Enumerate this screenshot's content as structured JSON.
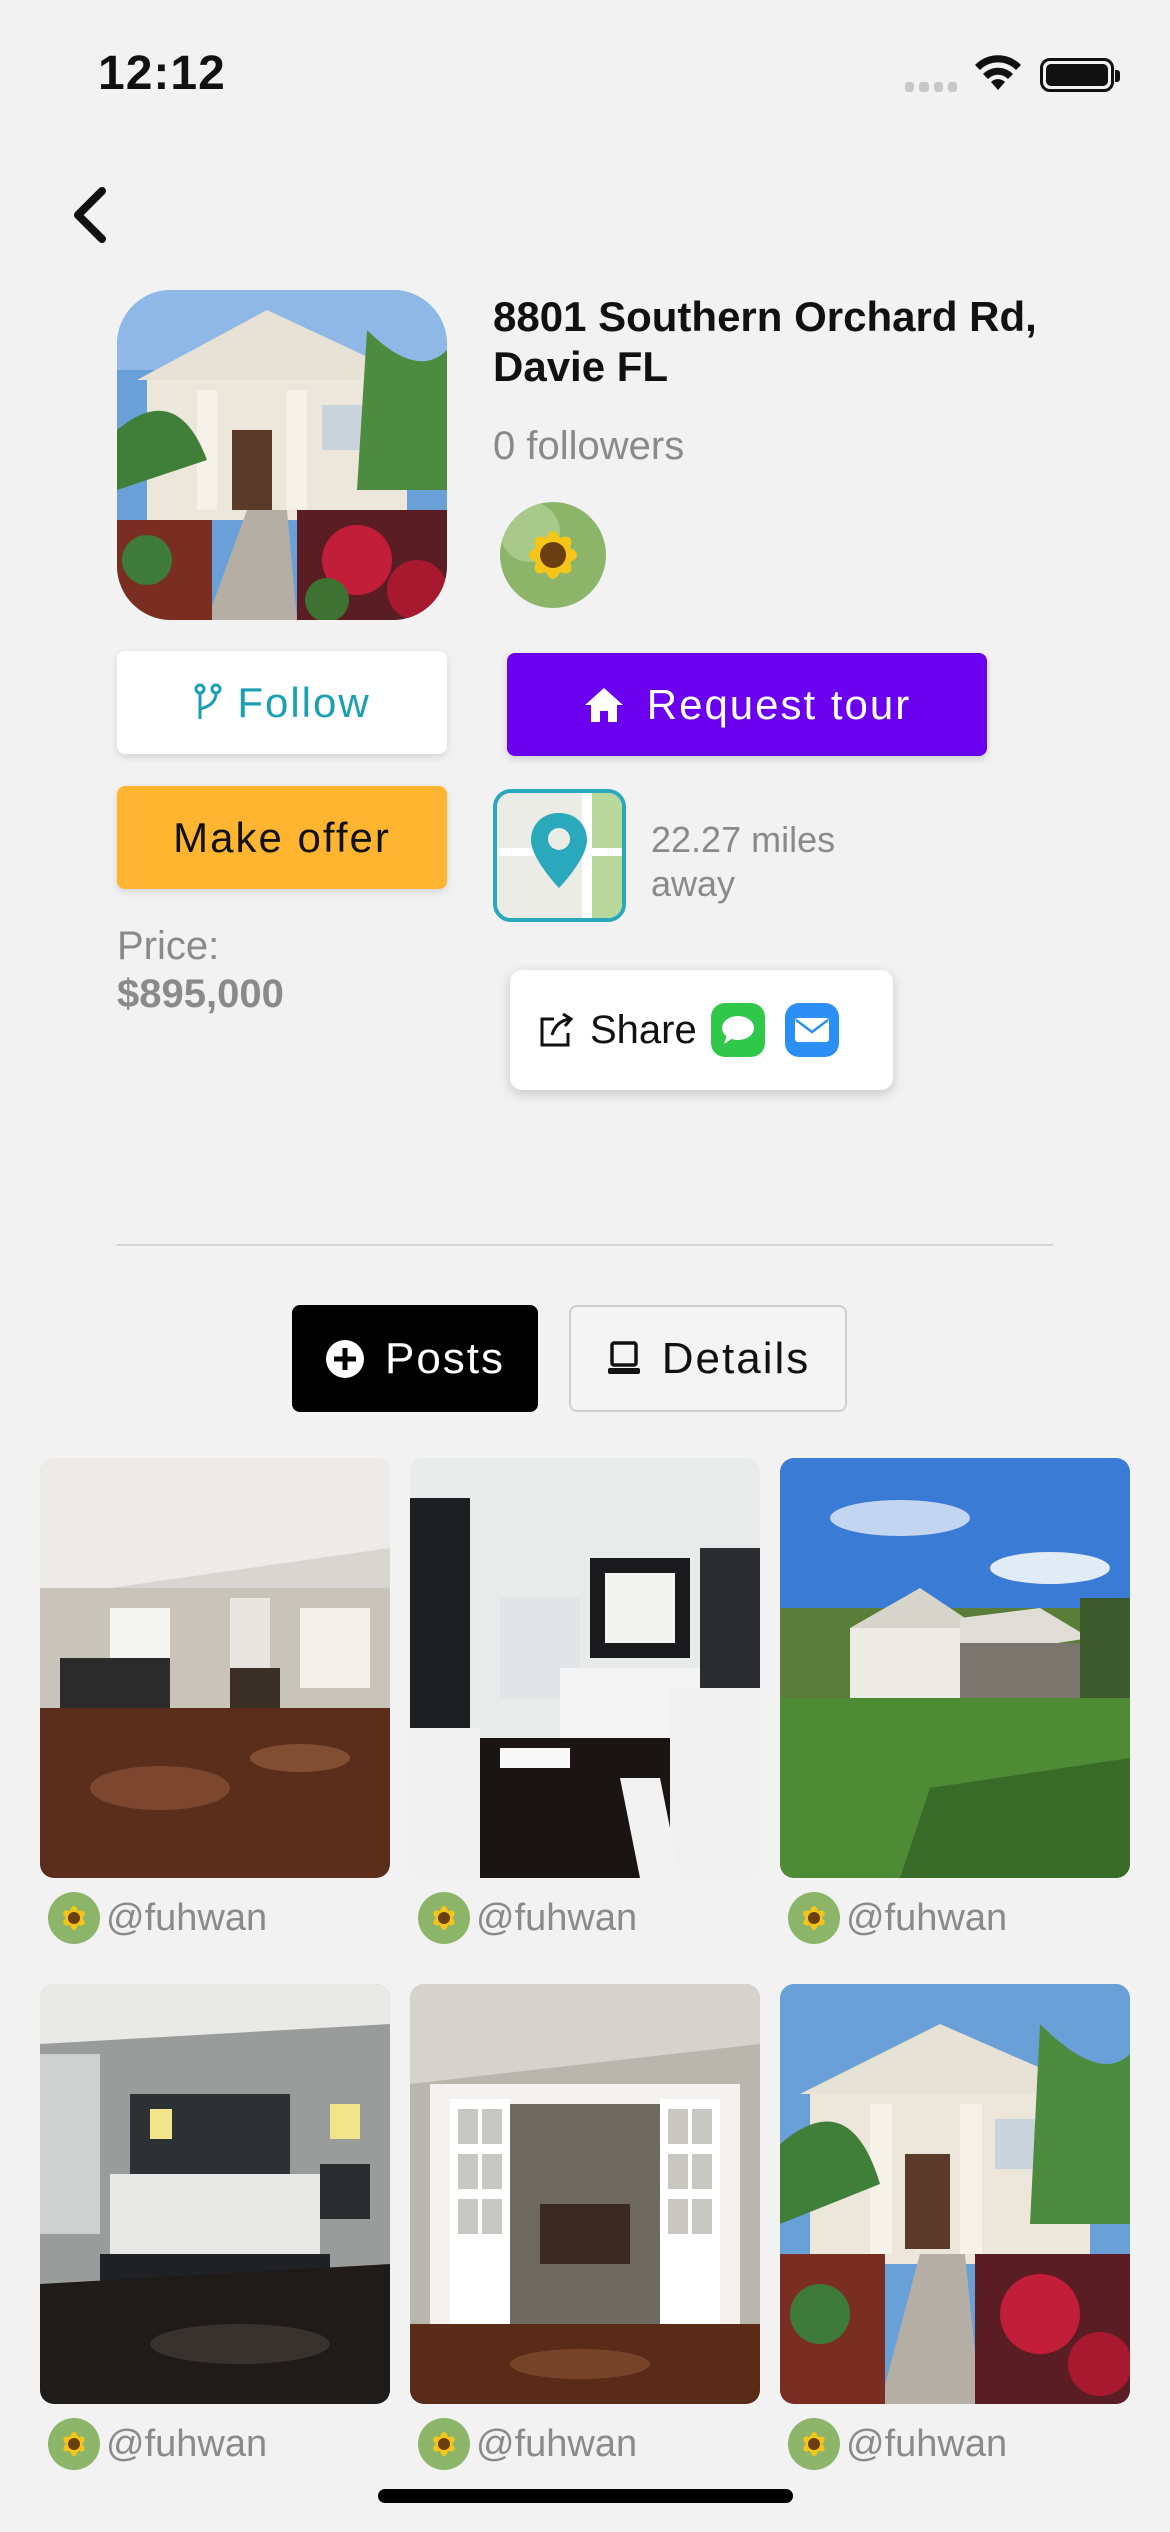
{
  "status_bar": {
    "time": "12:12"
  },
  "listing": {
    "address": "8801 Southern Orchard Rd, Davie FL",
    "followers": "0 followers",
    "price_label": "Price:",
    "price_value": "$895,000",
    "distance": "22.27 miles away"
  },
  "actions": {
    "follow_label": "Follow",
    "request_tour_label": "Request tour",
    "make_offer_label": "Make offer",
    "share_label": "Share"
  },
  "tabs": [
    {
      "label": "Posts",
      "active": true
    },
    {
      "label": "Details",
      "active": false
    }
  ],
  "posts": [
    {
      "handle": "@fuhwan",
      "scene": "living-room"
    },
    {
      "handle": "@fuhwan",
      "scene": "bathroom"
    },
    {
      "handle": "@fuhwan",
      "scene": "backyard"
    },
    {
      "handle": "@fuhwan",
      "scene": "bedroom"
    },
    {
      "handle": "@fuhwan",
      "scene": "french-doors"
    },
    {
      "handle": "@fuhwan",
      "scene": "front-entry"
    }
  ],
  "colors": {
    "accent_teal": "#1b9fb3",
    "tour_purple": "#6b00ee",
    "offer_orange": "#ffb530"
  }
}
